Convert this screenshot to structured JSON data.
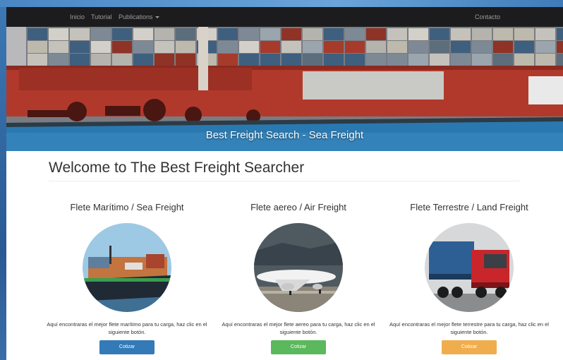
{
  "navbar": {
    "links": [
      "Inicio",
      "Tutorial",
      "Publications"
    ],
    "right_link": "Contacto"
  },
  "hero": {
    "caption": "Best Freight Search - Sea Freight",
    "slides": 3,
    "active_slide": 1
  },
  "main": {
    "heading": "Welcome to The Best Freight Searcher",
    "features": [
      {
        "title": "Flete Marítimo / Sea Freight",
        "text": "Aquí encontraras el mejor flete marítimo para tu carga, haz clic en el siguiente botón.",
        "button": "Cotizar",
        "color": "#337ab7",
        "icon": "container-ship-image"
      },
      {
        "title": "Flete aereo / Air Freight",
        "text": "Aquí encontraras el mejor flete aereo para tu carga, haz clic en el siguiente botón.",
        "button": "Cotizar",
        "color": "#5cb85c",
        "icon": "airplane-image"
      },
      {
        "title": "Flete Terrestre / Land Freight",
        "text": "Aquí encontraras el mejor flete terrestre para tu carga, haz clic en el siguiente botón.",
        "button": "Cotizar",
        "color": "#f0ad4e",
        "icon": "truck-image"
      }
    ]
  },
  "colors": {
    "navbar": "#1c1c1e",
    "nav_text": "#9c9c9c"
  }
}
